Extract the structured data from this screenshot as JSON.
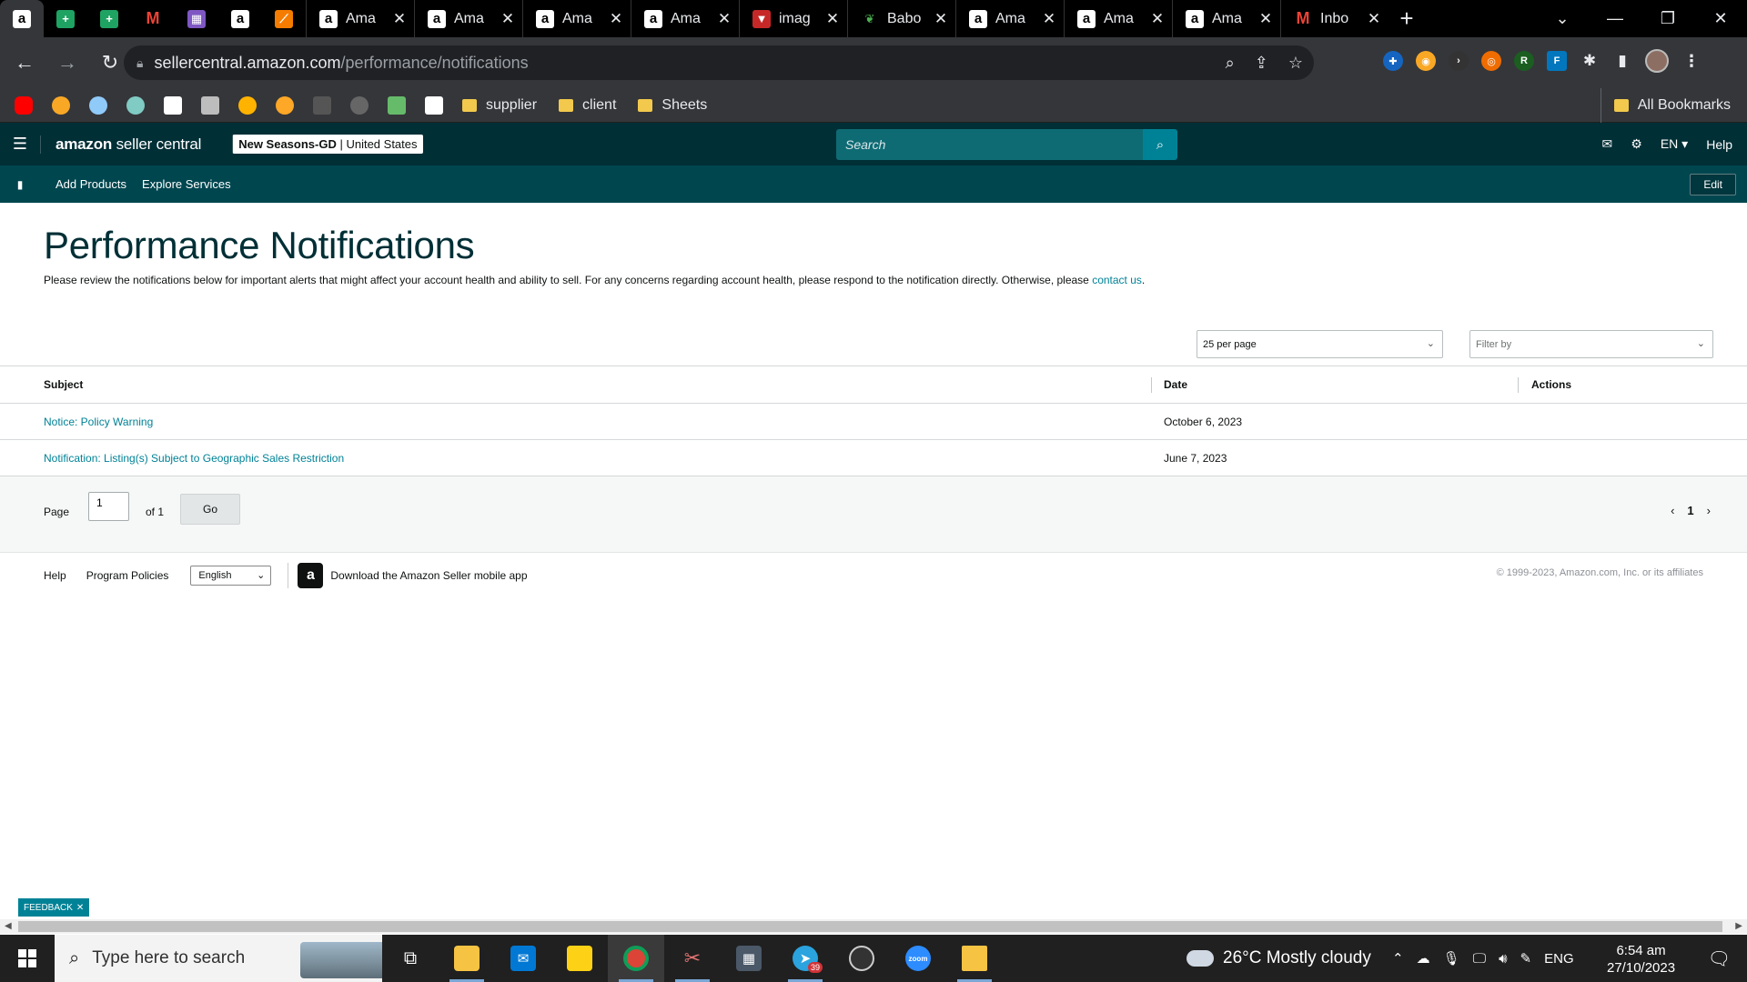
{
  "browser": {
    "tabs": [
      {
        "title": "Ama",
        "icon": "amazon-icon"
      },
      {
        "title": "Ama",
        "icon": "amazon-icon"
      },
      {
        "title": "Ama",
        "icon": "amazon-icon"
      },
      {
        "title": "Ama",
        "icon": "amazon-icon"
      },
      {
        "title": "imag",
        "icon": "image-icon"
      },
      {
        "title": "Babo",
        "icon": "leaf-icon"
      },
      {
        "title": "Ama",
        "icon": "amazon-icon"
      },
      {
        "title": "Ama",
        "icon": "amazon-icon"
      },
      {
        "title": "Ama",
        "icon": "amazon-icon"
      },
      {
        "title": "Inbo",
        "icon": "gmail-icon"
      }
    ],
    "url_host": "sellercentral.amazon.com",
    "url_path": "/performance/notifications",
    "bookmark_folders": [
      "supplier",
      "client",
      "Sheets"
    ],
    "all_bookmarks_label": "All Bookmarks"
  },
  "header": {
    "logo_bold": "amazon",
    "logo_rest": " seller central",
    "store_name": "New Seasons-GD",
    "store_region": " | United States",
    "search_placeholder": "Search",
    "lang": "EN ▾",
    "help": "Help"
  },
  "subnav": {
    "links": [
      "Add Products",
      "Explore Services"
    ],
    "edit": "Edit"
  },
  "page": {
    "title": "Performance Notifications",
    "description": "Please review the notifications below for important alerts that might affect your account health and ability to sell. For any concerns regarding account health, please respond to the notification directly. Otherwise, please ",
    "contact_link": "contact us",
    "description_end": ".",
    "per_page": "25 per page",
    "filter_placeholder": "Filter by"
  },
  "table": {
    "headers": {
      "subject": "Subject",
      "date": "Date",
      "actions": "Actions"
    },
    "rows": [
      {
        "subject": "Notice: Policy Warning",
        "date": "October 6, 2023"
      },
      {
        "subject": "Notification: Listing(s) Subject to Geographic Sales Restriction",
        "date": "June 7, 2023"
      }
    ]
  },
  "pager": {
    "label": "Page",
    "current": "1",
    "of": "of 1",
    "go": "Go",
    "page_number": "1"
  },
  "footer": {
    "help": "Help",
    "policies": "Program Policies",
    "language": "English",
    "app_text": "Download the Amazon Seller mobile app",
    "copyright": "© 1999-2023, Amazon.com, Inc. or its affiliates"
  },
  "feedback": "FEEDBACK",
  "taskbar": {
    "search_placeholder": "Type here to search",
    "telegram_badge": "39",
    "weather": "26°C  Mostly cloudy",
    "lang": "ENG",
    "time": "6:54 am",
    "date": "27/10/2023"
  },
  "colors": {
    "header_bg": "#002f36",
    "subnav_bg": "#00464f",
    "accent": "#008296",
    "title": "#002f36"
  }
}
